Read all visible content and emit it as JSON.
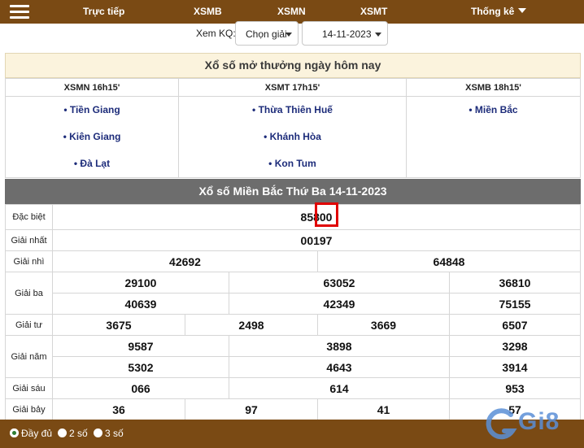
{
  "nav": {
    "items": [
      "Trực tiếp",
      "XSMB",
      "XSMN",
      "XSMT"
    ],
    "stats_label": "Thống kê"
  },
  "filter": {
    "label": "Xem KQ:",
    "province_select": "Chọn giải",
    "date_select": "14-11-2023"
  },
  "today": {
    "title": "Xổ số mở thưởng ngày hôm nay",
    "regions": [
      {
        "header": "XSMN 16h15'",
        "provinces": [
          "• Tiền Giang",
          "• Kiên Giang",
          "• Đà Lạt"
        ]
      },
      {
        "header": "XSMT 17h15'",
        "provinces": [
          "• Thừa Thiên Huế",
          "• Khánh Hòa",
          "• Kon Tum"
        ]
      },
      {
        "header": "XSMB 18h15'",
        "provinces": [
          "• Miền Bắc"
        ]
      }
    ]
  },
  "results": {
    "title": "Xổ số Miền Bắc Thứ Ba 14-11-2023",
    "labels": [
      "Đặc biệt",
      "Giải nhất",
      "Giải nhì",
      "Giải ba",
      "Giải tư",
      "Giải năm",
      "Giải sáu",
      "Giải bảy"
    ],
    "special": "85800",
    "first": "00197",
    "second": [
      "42692",
      "64848"
    ],
    "third": [
      "29100",
      "63052",
      "36810",
      "40639",
      "42349",
      "75155"
    ],
    "fourth": [
      "3675",
      "2498",
      "3669",
      "6507"
    ],
    "fifth": [
      "9587",
      "3898",
      "3298",
      "5302",
      "4643",
      "3914"
    ],
    "sixth": [
      "066",
      "614",
      "953"
    ],
    "seventh": [
      "36",
      "97",
      "41",
      "57"
    ]
  },
  "display_options": {
    "options": [
      "Đầy đủ",
      "2 số",
      "3 số"
    ],
    "selected": "Đầy đủ"
  },
  "logo": {
    "text": "Gi8"
  },
  "colors": {
    "brand": "#7a4a14",
    "result_header": "#6d6d6d",
    "special_prize": "#b24a3c",
    "province_link": "#1d2c7a",
    "highlight": "#e00000"
  }
}
